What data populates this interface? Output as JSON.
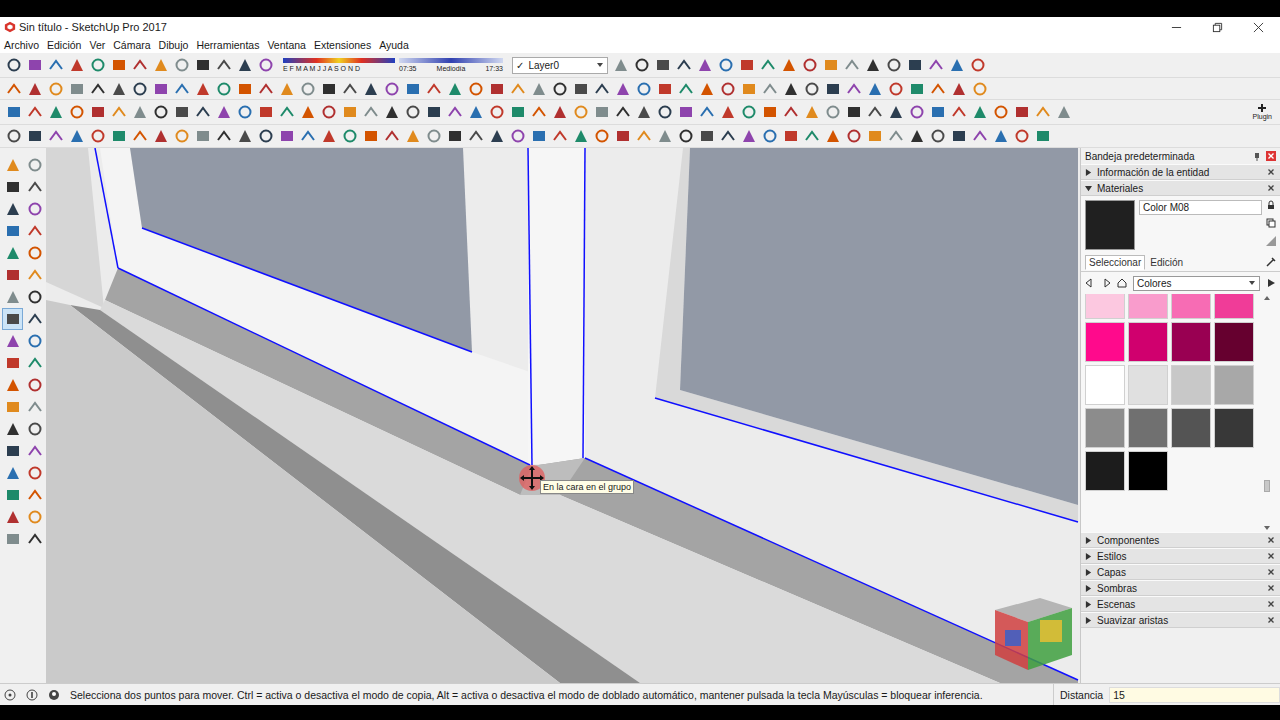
{
  "window": {
    "title": "Sin título - SketchUp Pro 2017"
  },
  "menu": [
    "Archivo",
    "Edición",
    "Ver",
    "Cámara",
    "Dibujo",
    "Herramientas",
    "Ventana",
    "Extensiones",
    "Ayuda"
  ],
  "toolbar": {
    "shadow": {
      "months": "E F M A M J J A S O N D",
      "sunrise": "07:35",
      "noon": "Mediodía",
      "sunset": "17:33"
    },
    "layer": {
      "check": "✓",
      "name": "Layer0"
    },
    "plugin_label": "Plugin"
  },
  "tools": [
    {
      "selected": false
    },
    {
      "selected": false
    },
    {
      "selected": false
    },
    {
      "selected": false
    },
    {
      "selected": false
    },
    {
      "selected": false
    },
    {
      "selected": false
    },
    {
      "selected": false
    },
    {
      "selected": false
    },
    {
      "selected": false
    },
    {
      "selected": false
    },
    {
      "selected": false
    },
    {
      "selected": false
    },
    {
      "selected": false
    },
    {
      "selected": true
    },
    {
      "selected": false
    },
    {
      "selected": false
    },
    {
      "selected": false
    },
    {
      "selected": false
    },
    {
      "selected": false
    },
    {
      "selected": false
    },
    {
      "selected": false
    },
    {
      "selected": false
    },
    {
      "selected": false
    },
    {
      "selected": false
    },
    {
      "selected": false
    },
    {
      "selected": false
    },
    {
      "selected": false
    },
    {
      "selected": false
    },
    {
      "selected": false
    },
    {
      "selected": false
    },
    {
      "selected": false
    },
    {
      "selected": false
    },
    {
      "selected": false
    },
    {
      "selected": false
    },
    {
      "selected": false
    }
  ],
  "viewport": {
    "tooltip": "En la cara en el grupo"
  },
  "tray": {
    "title": "Bandeja predeterminada",
    "panels": [
      {
        "name": "Información de la entidad",
        "expanded": false
      },
      {
        "name": "Materiales",
        "expanded": true
      },
      {
        "name": "Componentes",
        "expanded": false
      },
      {
        "name": "Estilos",
        "expanded": false
      },
      {
        "name": "Capas",
        "expanded": false
      },
      {
        "name": "Sombras",
        "expanded": false
      },
      {
        "name": "Escenas",
        "expanded": false
      },
      {
        "name": "Suavizar aristas",
        "expanded": false
      }
    ],
    "materials": {
      "name": "Color M08",
      "color": "#202020",
      "tabs": [
        {
          "label": "Seleccionar",
          "selected": true
        },
        {
          "label": "Edición",
          "selected": false
        }
      ],
      "library": "Colores",
      "swatches": [
        {
          "color": "#fcc8e0"
        },
        {
          "color": "#f99ccc"
        },
        {
          "color": "#f76cb4"
        },
        {
          "color": "#f03c98"
        },
        {
          "color": "#ff0a8c"
        },
        {
          "color": "#d0006e"
        },
        {
          "color": "#990052"
        },
        {
          "color": "#66002f"
        },
        {
          "color": "#ffffff"
        },
        {
          "color": "#e0e0e0"
        },
        {
          "color": "#c8c8c8"
        },
        {
          "color": "#a8a8a8"
        },
        {
          "color": "#8c8c8c"
        },
        {
          "color": "#707070"
        },
        {
          "color": "#545454"
        },
        {
          "color": "#383838"
        },
        {
          "color": "#1c1c1c"
        },
        {
          "color": "#000000"
        }
      ]
    }
  },
  "status_bar": {
    "hint": "Selecciona dos puntos para mover. Ctrl = activa o desactiva el modo de copia, Alt = activa o desactiva el modo de doblado automático, mantener pulsada la tecla Mayúsculas = bloquear inferencia.",
    "measure_label": "Distancia",
    "measure_value": "15"
  }
}
